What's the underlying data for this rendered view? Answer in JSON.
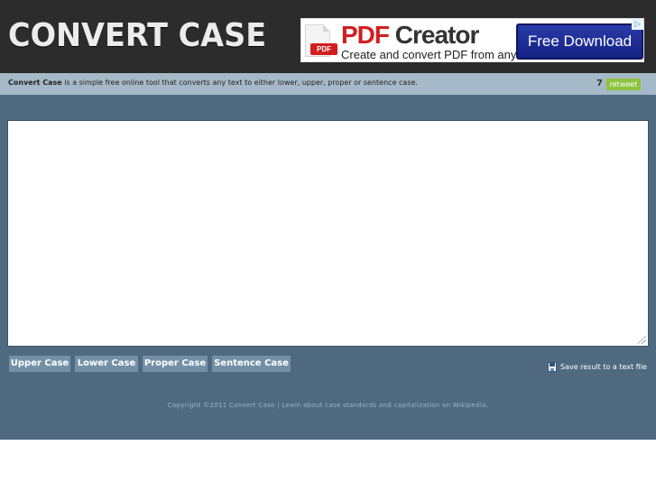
{
  "header": {
    "logo_text": "CONVERT CASE"
  },
  "ad": {
    "title_red": "PDF",
    "title_rest": " Creator",
    "subtitle": "Create and convert PDF from any file.",
    "badge": "PDF",
    "button_label": "Free Download",
    "choice_glyph": "▷"
  },
  "infobar": {
    "brand": "Convert Case",
    "description": " is a simple free online tool that converts any text to either lower, upper, proper or sentence case.",
    "retweet_count": "7",
    "retweet_label": "retweet"
  },
  "editor": {
    "value": "",
    "placeholder": ""
  },
  "buttons": {
    "upper": "Upper Case",
    "lower": "Lower Case",
    "proper": "Proper Case",
    "sentence": "Sentence Case"
  },
  "save": {
    "label": "Save result to a text file"
  },
  "footer": {
    "copyright": "Copyright ©2011 Convert Case | ",
    "link": "Learn about case standards and capitalization on Wikipedia."
  },
  "colors": {
    "header_bg": "#2c2c2c",
    "infobar_bg": "#a6b9c8",
    "main_bg": "#4f6a80",
    "button_bg": "#7390a6",
    "retweet_green": "#8dc43f"
  }
}
